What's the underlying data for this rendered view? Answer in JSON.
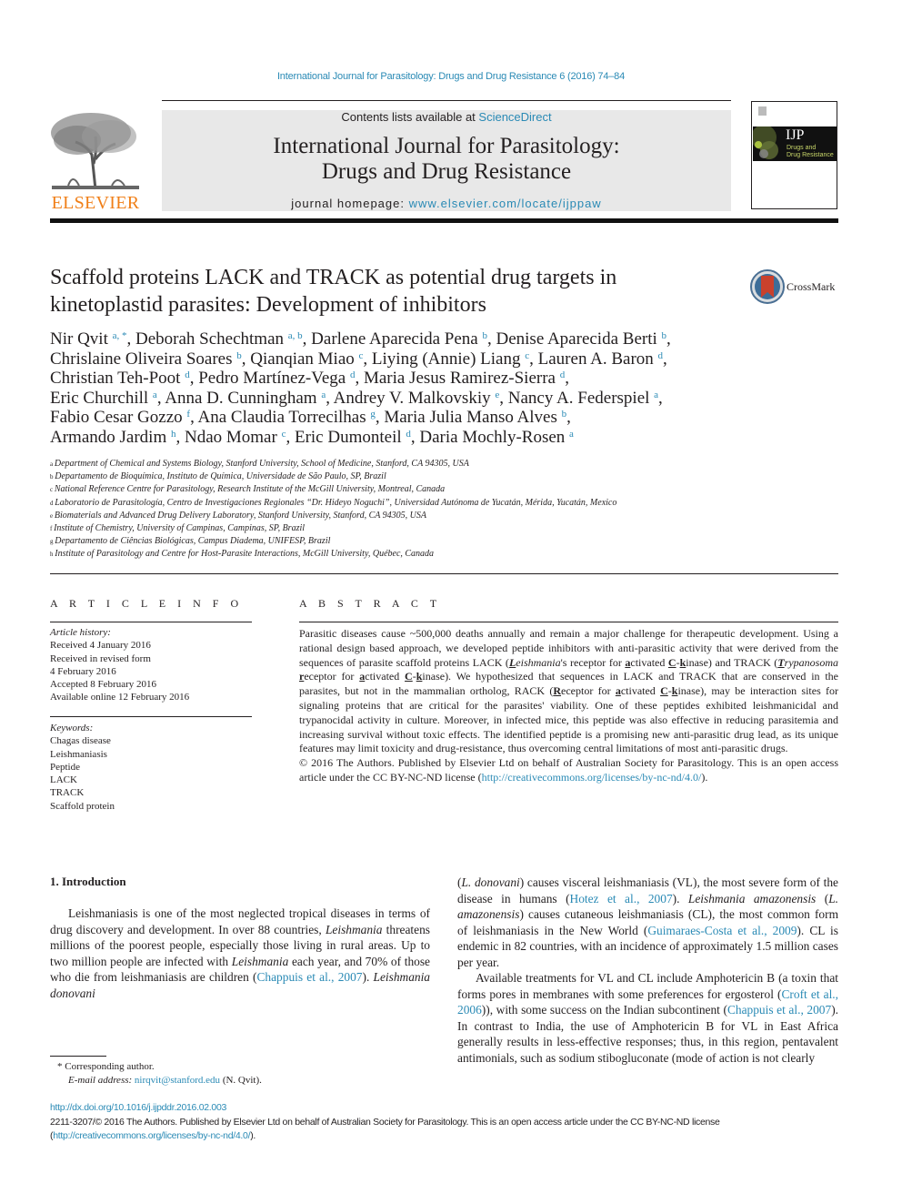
{
  "running_head": "International Journal for Parasitology: Drugs and Drug Resistance 6 (2016) 74–84",
  "masthead": {
    "contents_prefix": "Contents lists available at ",
    "contents_link": "ScienceDirect",
    "journal_line1": "International Journal for Parasitology:",
    "journal_line2": "Drugs and Drug Resistance",
    "homepage_prefix": "journal homepage: ",
    "homepage_link": "www.elsevier.com/locate/ijppaw",
    "publisher_logo": "ELSEVIER",
    "cover_title": "IJP",
    "cover_sub1": "Drugs and",
    "cover_sub2": "Drug Resistance"
  },
  "title_line1": "Scaffold proteins LACK and TRACK as potential drug targets in",
  "title_line2": "kinetoplastid parasites: Development of inhibitors",
  "crossmark_label": "CrossMark",
  "authors": [
    {
      "name": "Nir Qvit",
      "aff": "a, *",
      "sep": ", "
    },
    {
      "name": "Deborah Schechtman",
      "aff": "a, b",
      "sep": ", "
    },
    {
      "name": "Darlene Aparecida Pena",
      "aff": "b",
      "sep": ", "
    },
    {
      "name": "Denise Aparecida Berti",
      "aff": "b",
      "sep": ","
    },
    {
      "name": "Chrislaine Oliveira Soares",
      "aff": "b",
      "sep": ", "
    },
    {
      "name": "Qianqian Miao",
      "aff": "c",
      "sep": ", "
    },
    {
      "name": "Liying (Annie) Liang",
      "aff": "c",
      "sep": ", "
    },
    {
      "name": "Lauren A. Baron",
      "aff": "d",
      "sep": ","
    },
    {
      "name": "Christian Teh-Poot",
      "aff": "d",
      "sep": ", "
    },
    {
      "name": "Pedro Martínez-Vega",
      "aff": "d",
      "sep": ", "
    },
    {
      "name": "Maria Jesus Ramirez-Sierra",
      "aff": "d",
      "sep": ","
    },
    {
      "name": "Eric Churchill",
      "aff": "a",
      "sep": ", "
    },
    {
      "name": "Anna D. Cunningham",
      "aff": "a",
      "sep": ", "
    },
    {
      "name": "Andrey V. Malkovskiy",
      "aff": "e",
      "sep": ", "
    },
    {
      "name": "Nancy A. Federspiel",
      "aff": "a",
      "sep": ","
    },
    {
      "name": "Fabio Cesar Gozzo",
      "aff": "f",
      "sep": ", "
    },
    {
      "name": "Ana Claudia Torrecilhas",
      "aff": "g",
      "sep": ", "
    },
    {
      "name": "Maria Julia Manso Alves",
      "aff": "b",
      "sep": ","
    },
    {
      "name": "Armando Jardim",
      "aff": "h",
      "sep": ", "
    },
    {
      "name": "Ndao Momar",
      "aff": "c",
      "sep": ", "
    },
    {
      "name": "Eric Dumonteil",
      "aff": "d",
      "sep": ", "
    },
    {
      "name": "Daria Mochly-Rosen",
      "aff": "a",
      "sep": ""
    }
  ],
  "affiliations": [
    {
      "key": "a",
      "text": "Department of Chemical and Systems Biology, Stanford University, School of Medicine, Stanford, CA 94305, USA"
    },
    {
      "key": "b",
      "text": "Departamento de Bioquímica, Instituto de Química, Universidade de São Paulo, SP, Brazil"
    },
    {
      "key": "c",
      "text": "National Reference Centre for Parasitology, Research Institute of the McGill University, Montreal, Canada"
    },
    {
      "key": "d",
      "text": "Laboratorio de Parasitología, Centro de Investigaciones Regionales “Dr. Hideyo Noguchi”, Universidad Autónoma de Yucatán, Mérida, Yucatán, Mexico"
    },
    {
      "key": "e",
      "text": "Biomaterials and Advanced Drug Delivery Laboratory, Stanford University, Stanford, CA 94305, USA"
    },
    {
      "key": "f",
      "text": "Institute of Chemistry, University of Campinas, Campinas, SP, Brazil"
    },
    {
      "key": "g",
      "text": "Departamento de Ciências Biológicas, Campus Diadema, UNIFESP, Brazil"
    },
    {
      "key": "h",
      "text": "Institute of Parasitology and Centre for Host-Parasite Interactions, McGill University, Québec, Canada"
    }
  ],
  "article_info": {
    "heading": "A R T I C L E   I N F O",
    "history_label": "Article history:",
    "history": [
      "Received 4 January 2016",
      "Received in revised form",
      "4 February 2016",
      "Accepted 8 February 2016",
      "Available online 12 February 2016"
    ],
    "keywords_label": "Keywords:",
    "keywords": [
      "Chagas disease",
      "Leishmaniasis",
      "Peptide",
      "LACK",
      "TRACK",
      "Scaffold protein"
    ]
  },
  "abstract": {
    "heading": "A B S T R A C T",
    "p1": "Parasitic diseases cause ~500,000 deaths annually and remain a major challenge for therapeutic development. Using a rational design based approach, we developed peptide inhibitors with anti-parasitic activity that were derived from the sequences of parasite scaffold proteins LACK (",
    "lack_def": "Leishmania's receptor for activated C-kinase",
    "p1b": ") and TRACK (",
    "track_def": "Trypanosoma receptor for activated C-kinase",
    "p1c": "). We hypothesized that sequences in LACK and TRACK that are conserved in the parasites, but not in the mammalian ortholog, RACK (",
    "rack_def": "Receptor for activated C-kinase",
    "p1d": "), may be interaction sites for signaling proteins that are critical for the parasites' viability. One of these peptides exhibited leishmanicidal and trypanocidal activity in culture. Moreover, in infected mice, this peptide was also effective in reducing parasitemia and increasing survival without toxic effects. The identified peptide is a promising new anti-parasitic drug lead, as its unique features may limit toxicity and drug-resistance, thus overcoming central limitations of most anti-parasitic drugs.",
    "copyright": "© 2016 The Authors. Published by Elsevier Ltd on behalf of Australian Society for Parasitology. This is an open access article under the CC BY-NC-ND license (",
    "license_link": "http://creativecommons.org/licenses/by-nc-nd/4.0/",
    "copyright_end": ")."
  },
  "intro": {
    "heading": "1.  Introduction",
    "col1": [
      {
        "t": "Leishmaniasis is one of the most neglected tropical diseases in terms of drug discovery and development. In over 88 countries, "
      },
      {
        "t": "Leishmania",
        "i": true
      },
      {
        "t": " threatens millions of the poorest people, especially those living in rural areas. Up to two million people are infected with "
      },
      {
        "t": "Leishmania",
        "i": true
      },
      {
        "t": " each year, and 70% of those who die from leishmaniasis are children ("
      },
      {
        "t": "Chappuis et al., 2007",
        "l": true
      },
      {
        "t": "). "
      },
      {
        "t": "Leishmania donovani",
        "i": true
      }
    ],
    "col2_p1": [
      {
        "t": "("
      },
      {
        "t": "L. donovani",
        "i": true
      },
      {
        "t": ") causes visceral leishmaniasis (VL), the most severe form of the disease in humans ("
      },
      {
        "t": "Hotez et al., 2007",
        "l": true
      },
      {
        "t": "). "
      },
      {
        "t": "Leishmania amazonensis",
        "i": true
      },
      {
        "t": " ("
      },
      {
        "t": "L. amazonensis",
        "i": true
      },
      {
        "t": ") causes cutaneous leishmaniasis (CL), the most common form of leishmaniasis in the New World ("
      },
      {
        "t": "Guimaraes-Costa et al., 2009",
        "l": true
      },
      {
        "t": "). CL is endemic in 82 countries, with an incidence of approximately 1.5 million cases per year."
      }
    ],
    "col2_p2": [
      {
        "t": "Available treatments for VL and CL include Amphotericin B (a toxin that forms pores in membranes with some preferences for ergosterol ("
      },
      {
        "t": "Croft et al., 2006",
        "l": true
      },
      {
        "t": ")), with some success on the Indian subcontinent ("
      },
      {
        "t": "Chappuis et al., 2007",
        "l": true
      },
      {
        "t": "). In contrast to India, the use of Amphotericin B for VL in East Africa generally results in less-effective responses; thus, in this region, pentavalent antimonials, such as sodium stibogluconate (mode of action is not clearly"
      }
    ]
  },
  "footnote": {
    "star_text": "* Corresponding author.",
    "email_label": "E-mail address: ",
    "email": "nirqvit@stanford.edu",
    "email_suffix": " (N. Qvit)."
  },
  "bottom": {
    "doi": "http://dx.doi.org/10.1016/j.ijpddr.2016.02.003",
    "license_text": "2211-3207/© 2016 The Authors. Published by Elsevier Ltd on behalf of Australian Society for Parasitology. This is an open access article under the CC BY-NC-ND license (",
    "license_link": "http://creativecommons.org/licenses/by-nc-nd/4.0/",
    "license_end": ")."
  },
  "colors": {
    "link": "#2a8ab5",
    "elsevier_orange": "#f07f18",
    "masthead_bg": "#e8e8e8"
  }
}
